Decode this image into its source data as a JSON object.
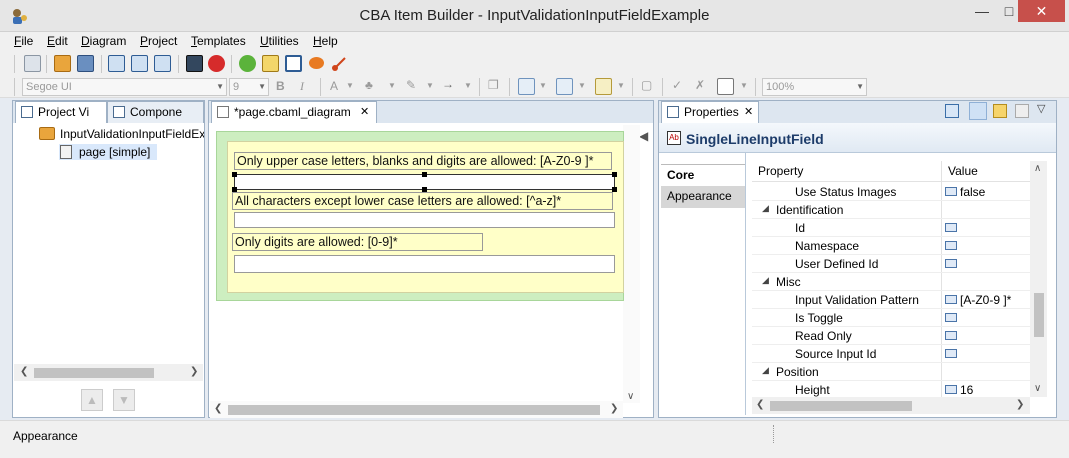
{
  "window": {
    "title": "CBA Item Builder - InputValidationInputFieldExample"
  },
  "menu": [
    "File",
    "Edit",
    "Diagram",
    "Project",
    "Templates",
    "Utilities",
    "Help"
  ],
  "toolbar": {
    "font": "Segoe UI",
    "font_size": "9",
    "zoom": "100%",
    "bold": "B",
    "italic": "I",
    "font_color": "A"
  },
  "left_panel": {
    "tabs": [
      "Project Vi",
      "Compone"
    ],
    "tree": [
      {
        "label": "InputValidationInputFieldEx",
        "icon": "project-folder-icon"
      },
      {
        "label": "page [simple]",
        "icon": "page-icon"
      }
    ]
  },
  "editor": {
    "tab": "*page.cbaml_diagram",
    "labels": [
      "Only upper case letters, blanks and digits are allowed: [A-Z0-9 ]*",
      "All characters except lower case letters are allowed: [^a-z]*",
      "Only digits are allowed: [0-9]*"
    ]
  },
  "properties": {
    "tab": "Properties",
    "title": "SingleLineInputField",
    "title_icon": "Ab",
    "categories": [
      "Core",
      "Appearance"
    ],
    "columns": {
      "property": "Property",
      "value": "Value"
    },
    "rows": [
      {
        "name": "Use Status Images",
        "value": "false",
        "type": "prop"
      },
      {
        "name": "Identification",
        "type": "group"
      },
      {
        "name": "Id",
        "value": "",
        "type": "prop"
      },
      {
        "name": "Namespace",
        "value": "",
        "type": "prop"
      },
      {
        "name": "User Defined Id",
        "value": "",
        "type": "prop"
      },
      {
        "name": "Misc",
        "type": "group"
      },
      {
        "name": "Input Validation Pattern",
        "value": "[A-Z0-9 ]*",
        "type": "prop"
      },
      {
        "name": "Is Toggle",
        "value": "",
        "type": "prop"
      },
      {
        "name": "Read Only",
        "value": "",
        "type": "prop"
      },
      {
        "name": "Source Input Id",
        "value": "",
        "type": "prop"
      },
      {
        "name": "Position",
        "type": "group"
      },
      {
        "name": "Height",
        "value": "16",
        "type": "prop"
      }
    ]
  },
  "status": {
    "text": "Appearance"
  }
}
